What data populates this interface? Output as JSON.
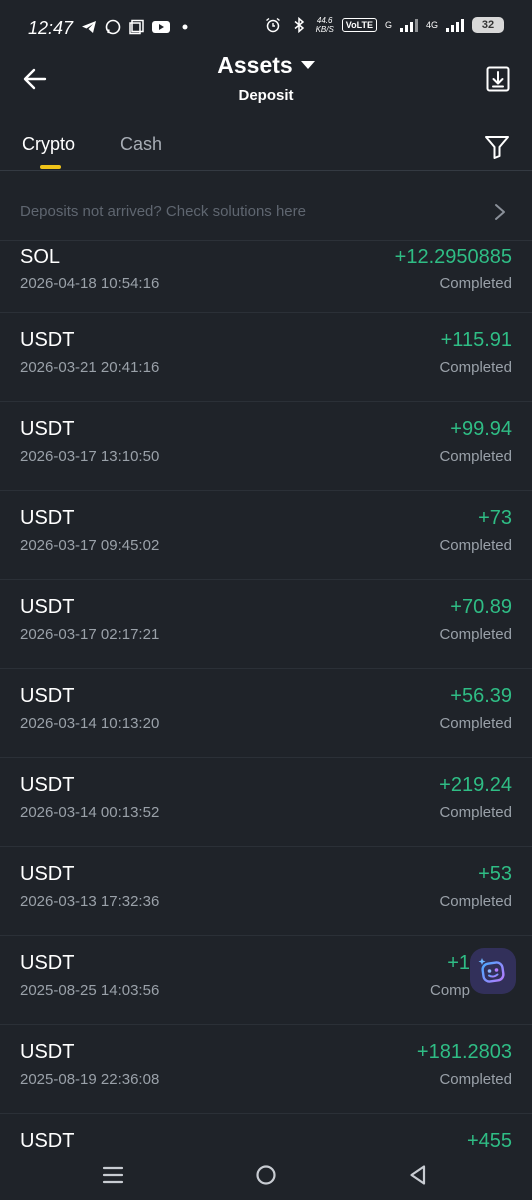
{
  "status_bar": {
    "time": "12:47",
    "net_speed_value": "44.6",
    "net_speed_unit": "KB/S",
    "volte": "VoLTE",
    "network_1": "G",
    "network_2": "4G",
    "battery": "32"
  },
  "header": {
    "title": "Assets",
    "subtitle": "Deposit"
  },
  "tabs": [
    {
      "label": "Crypto",
      "active": true
    },
    {
      "label": "Cash",
      "active": false
    }
  ],
  "notice": {
    "text": "Deposits not arrived? Check solutions here"
  },
  "deposits": [
    {
      "coin": "SOL",
      "date": "2026-04-18 10:54:16",
      "amount": "+12.2950885",
      "status": "Completed"
    },
    {
      "coin": "USDT",
      "date": "2026-03-21 20:41:16",
      "amount": "+115.91",
      "status": "Completed"
    },
    {
      "coin": "USDT",
      "date": "2026-03-17 13:10:50",
      "amount": "+99.94",
      "status": "Completed"
    },
    {
      "coin": "USDT",
      "date": "2026-03-17 09:45:02",
      "amount": "+73",
      "status": "Completed"
    },
    {
      "coin": "USDT",
      "date": "2026-03-17 02:17:21",
      "amount": "+70.89",
      "status": "Completed"
    },
    {
      "coin": "USDT",
      "date": "2026-03-14 10:13:20",
      "amount": "+56.39",
      "status": "Completed"
    },
    {
      "coin": "USDT",
      "date": "2026-03-14 00:13:52",
      "amount": "+219.24",
      "status": "Completed"
    },
    {
      "coin": "USDT",
      "date": "2026-03-13 17:32:36",
      "amount": "+53",
      "status": "Completed"
    },
    {
      "coin": "USDT",
      "date": "2025-08-25 14:03:56",
      "amount": "+1",
      "status": "Comp"
    },
    {
      "coin": "USDT",
      "date": "2025-08-19 22:36:08",
      "amount": "+181.2803",
      "status": "Completed"
    },
    {
      "coin": "USDT",
      "date": "",
      "amount": "+455",
      "status": ""
    }
  ],
  "colors": {
    "background": "#1f2329",
    "positive": "#2fbd85",
    "accent": "#f0c419",
    "muted": "#9aa1a9"
  },
  "icons": {
    "back": "arrow-left-icon",
    "title_dropdown": "caret-down-icon",
    "download": "download-icon",
    "filter": "filter-icon",
    "notice": "chevron-right-icon",
    "assistant": "ai-assistant-icon",
    "nav": [
      "menu-icon",
      "home-circle-icon",
      "back-triangle-icon"
    ]
  }
}
